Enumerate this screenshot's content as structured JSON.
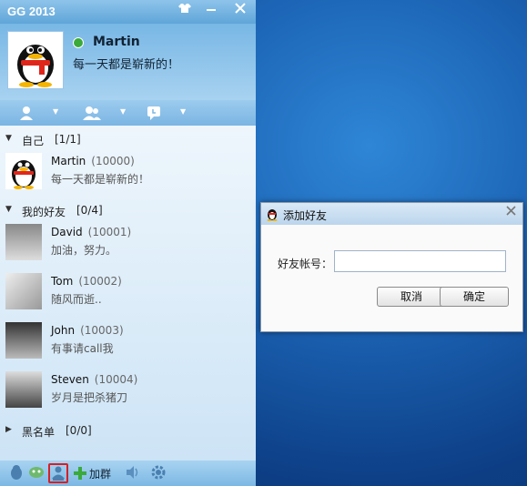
{
  "window": {
    "title": "GG 2013"
  },
  "profile": {
    "name": "Martin",
    "signature": "每一天都是崭新的！"
  },
  "groups": [
    {
      "name": "自己",
      "count": "[1/1]"
    },
    {
      "name": "我的好友",
      "count": "[0/4]"
    },
    {
      "name": "黑名单",
      "count": "[0/0]"
    }
  ],
  "contacts": [
    {
      "name": "Martin",
      "id": "(10000)",
      "signature": "每一天都是崭新的！"
    },
    {
      "name": "David",
      "id": "(10001)",
      "signature": "加油，努力。"
    },
    {
      "name": "Tom",
      "id": "(10002)",
      "signature": "随风而逝.."
    },
    {
      "name": "John",
      "id": "(10003)",
      "signature": "有事请call我"
    },
    {
      "name": "Steven",
      "id": "(10004)",
      "signature": "岁月是把杀猪刀"
    }
  ],
  "bottombar": {
    "add_group_label": "加群"
  },
  "dialog": {
    "title": "添加好友",
    "account_label": "好友帐号：",
    "account_value": "",
    "cancel_label": "取消",
    "confirm_label": "确定"
  },
  "colors": {
    "accent": "#5fa5d9",
    "highlight": "#d61f26"
  }
}
